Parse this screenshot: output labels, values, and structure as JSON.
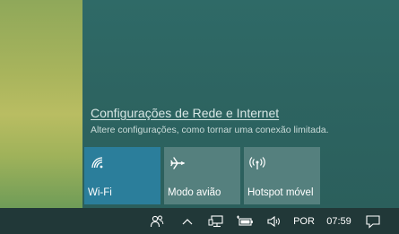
{
  "flyout": {
    "settings_link": "Configurações de Rede e Internet",
    "settings_description": "Altere configurações, como tornar uma conexão limitada.",
    "tiles": [
      {
        "label": "Wi-Fi",
        "icon": "wifi-icon",
        "active": true
      },
      {
        "label": "Modo avião",
        "icon": "airplane-icon",
        "active": false
      },
      {
        "label": "Hotspot móvel",
        "icon": "hotspot-icon",
        "active": false
      }
    ]
  },
  "taskbar": {
    "icons": [
      "people-icon",
      "chevron-up-icon",
      "network-icon",
      "battery-icon",
      "volume-icon",
      "notification-icon"
    ],
    "language": "POR",
    "clock": "07:59"
  },
  "colors": {
    "flyout_background": "#2d6461",
    "tile_active": "#2b7e9b",
    "tile_inactive": "#55807e",
    "taskbar_background": "#213838"
  }
}
